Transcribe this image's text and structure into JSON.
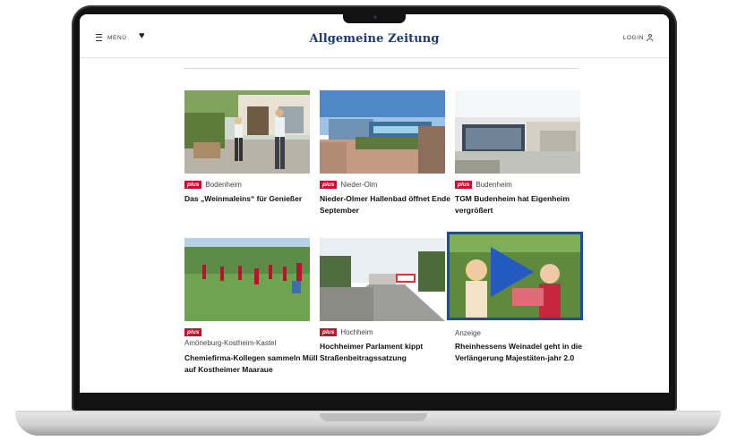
{
  "header": {
    "menu_label": "MENÜ",
    "logo_text": "Allgemeine Zeitung",
    "login_label": "LOGIN"
  },
  "colors": {
    "brand": "#1f3b6e",
    "plus_badge": "#c8102e",
    "video_border": "#1f4aa6"
  },
  "icons": [
    "hamburger-icon",
    "heart-icon",
    "user-icon",
    "play-icon"
  ],
  "plus_label": "plus",
  "articles": [
    {
      "kicker": "Bodenheim",
      "plus": true,
      "headline": "Das „Weinmaleins“ für Genießer"
    },
    {
      "kicker": "Nieder-Olm",
      "plus": true,
      "headline": "Nieder-Olmer Hallenbad öffnet Ende September"
    },
    {
      "kicker": "Budenheim",
      "plus": true,
      "headline": "TGM Budenheim hat Eigenheim vergrößert"
    },
    {
      "kicker": "Amöneburg-Kostheim-Kastel",
      "plus": true,
      "headline": "Chemiefirma-Kollegen sammeln Müll auf Kostheimer Maaraue"
    },
    {
      "kicker": "Hochheim",
      "plus": true,
      "headline": "Hochheimer Parlament kippt Straßenbeitragssatzung"
    },
    {
      "kicker": "Anzeige",
      "plus": false,
      "headline": "Rheinhessens Weinadel geht in die Verlängerung Majestäten-jahr 2.0"
    }
  ]
}
